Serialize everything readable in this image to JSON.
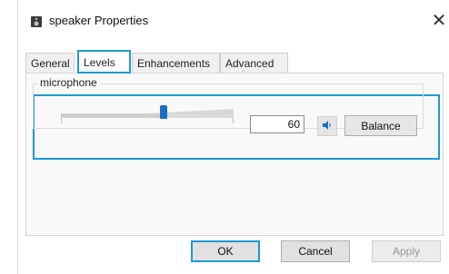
{
  "window": {
    "title": "speaker Properties",
    "close_glyph": "✕"
  },
  "tabs": [
    {
      "label": "General",
      "active": false
    },
    {
      "label": "Levels",
      "active": true
    },
    {
      "label": "Enhancements",
      "active": false
    },
    {
      "label": "Advanced",
      "active": false
    }
  ],
  "levels": {
    "group_label": "microphone",
    "slider_value_fraction": 0.6,
    "input_value": "60",
    "mute_icon": "speaker-icon",
    "balance_label": "Balance"
  },
  "footer": {
    "ok_label": "OK",
    "cancel_label": "Cancel",
    "apply_label": "Apply"
  },
  "colors": {
    "accent": "#1c9ad6",
    "slider_thumb": "#1a6fc2"
  }
}
